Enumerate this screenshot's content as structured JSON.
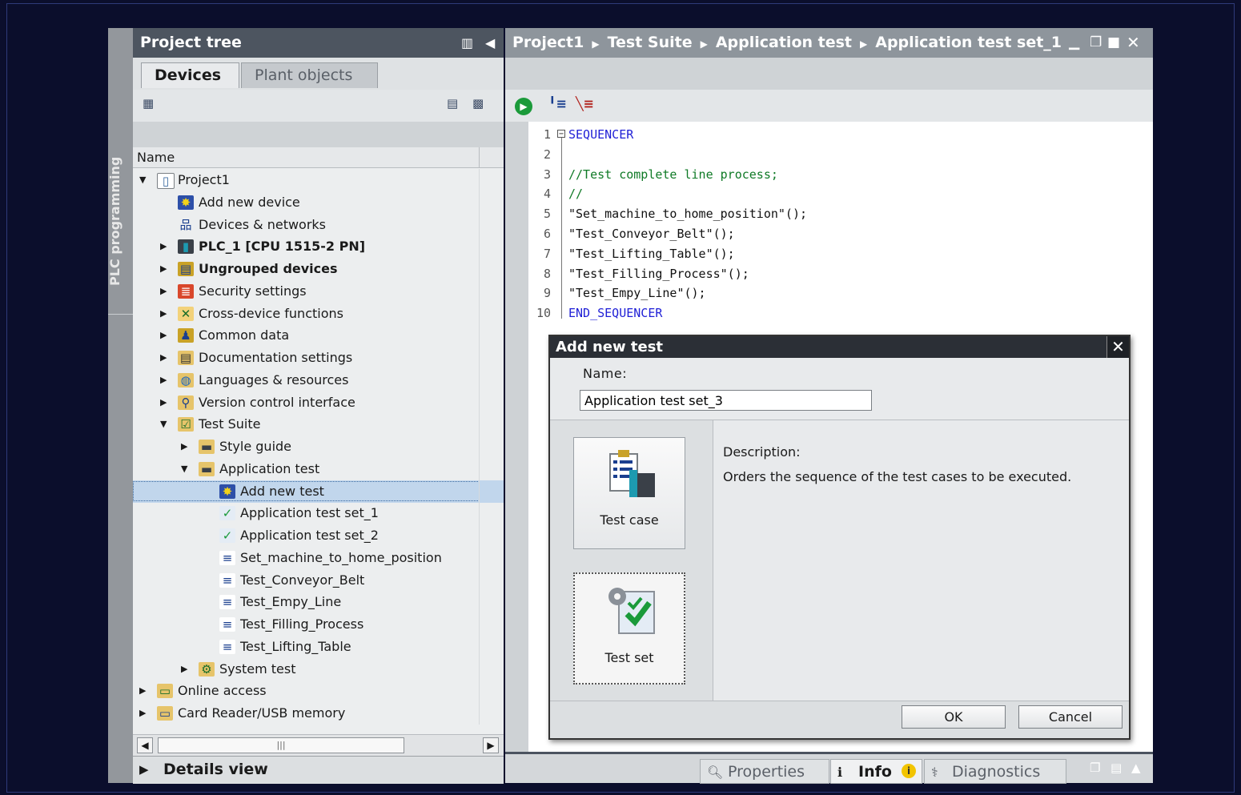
{
  "side_strip": {
    "label": "PLC programming"
  },
  "project_tree": {
    "title": "Project tree",
    "tabs": [
      "Devices",
      "Plant objects"
    ],
    "column_header": "Name",
    "items": [
      {
        "label": "Project1",
        "level": 0,
        "expander": "open",
        "icon": "project-icon",
        "bold": false
      },
      {
        "label": "Add new device",
        "level": 1,
        "expander": "none",
        "icon": "add-device-icon",
        "bold": false
      },
      {
        "label": "Devices & networks",
        "level": 1,
        "expander": "none",
        "icon": "network-icon",
        "bold": false
      },
      {
        "label": "PLC_1 [CPU 1515-2 PN]",
        "level": 1,
        "expander": "closed",
        "icon": "plc-icon",
        "bold": true
      },
      {
        "label": "Ungrouped devices",
        "level": 1,
        "expander": "closed",
        "icon": "ungrouped-devices-icon",
        "bold": true
      },
      {
        "label": "Security settings",
        "level": 1,
        "expander": "closed",
        "icon": "security-icon",
        "bold": false
      },
      {
        "label": "Cross-device functions",
        "level": 1,
        "expander": "closed",
        "icon": "cross-device-icon",
        "bold": false
      },
      {
        "label": "Common data",
        "level": 1,
        "expander": "closed",
        "icon": "common-data-icon",
        "bold": false
      },
      {
        "label": "Documentation settings",
        "level": 1,
        "expander": "closed",
        "icon": "documentation-icon",
        "bold": false
      },
      {
        "label": "Languages & resources",
        "level": 1,
        "expander": "closed",
        "icon": "languages-icon",
        "bold": false
      },
      {
        "label": "Version control interface",
        "level": 1,
        "expander": "closed",
        "icon": "version-control-icon",
        "bold": false
      },
      {
        "label": "Test Suite",
        "level": 1,
        "expander": "open",
        "icon": "test-suite-icon",
        "bold": false
      },
      {
        "label": "Style guide",
        "level": 2,
        "expander": "closed",
        "icon": "folder-icon",
        "bold": false
      },
      {
        "label": "Application test",
        "level": 2,
        "expander": "open",
        "icon": "folder-icon",
        "bold": false
      },
      {
        "label": "Add new test",
        "level": 3,
        "expander": "none",
        "icon": "add-test-icon",
        "bold": false,
        "selected": true
      },
      {
        "label": "Application test set_1",
        "level": 3,
        "expander": "none",
        "icon": "test-set-icon",
        "bold": false
      },
      {
        "label": "Application test set_2",
        "level": 3,
        "expander": "none",
        "icon": "test-set-icon",
        "bold": false
      },
      {
        "label": "Set_machine_to_home_position",
        "level": 3,
        "expander": "none",
        "icon": "test-case-icon",
        "bold": false
      },
      {
        "label": "Test_Conveyor_Belt",
        "level": 3,
        "expander": "none",
        "icon": "test-case-icon",
        "bold": false
      },
      {
        "label": "Test_Empy_Line",
        "level": 3,
        "expander": "none",
        "icon": "test-case-icon",
        "bold": false
      },
      {
        "label": "Test_Filling_Process",
        "level": 3,
        "expander": "none",
        "icon": "test-case-icon",
        "bold": false
      },
      {
        "label": "Test_Lifting_Table",
        "level": 3,
        "expander": "none",
        "icon": "test-case-icon",
        "bold": false
      },
      {
        "label": "System test",
        "level": 2,
        "expander": "closed",
        "icon": "system-test-icon",
        "bold": false
      },
      {
        "label": "Online access",
        "level": 0,
        "expander": "closed",
        "icon": "online-access-icon",
        "bold": false
      },
      {
        "label": "Card Reader/USB memory",
        "level": 0,
        "expander": "closed",
        "icon": "card-reader-icon",
        "bold": false
      }
    ],
    "details_view": "Details view"
  },
  "editor": {
    "breadcrumb": [
      "Project1",
      "Test Suite",
      "Application test",
      "Application test set_1"
    ],
    "code_lines": [
      {
        "num": "1",
        "text": "SEQUENCER",
        "kind": "keyword"
      },
      {
        "num": "2",
        "text": "",
        "kind": "plain"
      },
      {
        "num": "3",
        "text": "//Test complete line process;",
        "kind": "comment"
      },
      {
        "num": "4",
        "text": "//",
        "kind": "comment"
      },
      {
        "num": "5",
        "text": "\"Set_machine_to_home_position\"();",
        "kind": "plain"
      },
      {
        "num": "6",
        "text": "\"Test_Conveyor_Belt\"();",
        "kind": "plain"
      },
      {
        "num": "7",
        "text": "\"Test_Lifting_Table\"();",
        "kind": "plain"
      },
      {
        "num": "8",
        "text": "\"Test_Filling_Process\"();",
        "kind": "plain"
      },
      {
        "num": "9",
        "text": "\"Test_Empy_Line\"();",
        "kind": "plain"
      },
      {
        "num": "10",
        "text": "END_SEQUENCER",
        "kind": "keyword"
      }
    ],
    "bottom_tabs": [
      "Properties",
      "Info",
      "Diagnostics"
    ]
  },
  "dialog": {
    "title": "Add new test",
    "name_label": "Name:",
    "name_value": "Application test set_3",
    "options": [
      "Test case",
      "Test set"
    ],
    "description_label": "Description:",
    "description_text": "Orders the sequence of the test cases to be executed.",
    "ok_label": "OK",
    "cancel_label": "Cancel"
  },
  "colors": {
    "keyword": "#1f1fd6",
    "comment": "#0f7a26",
    "selection": "#c1d6ec",
    "title_bar": "#4d5560"
  }
}
